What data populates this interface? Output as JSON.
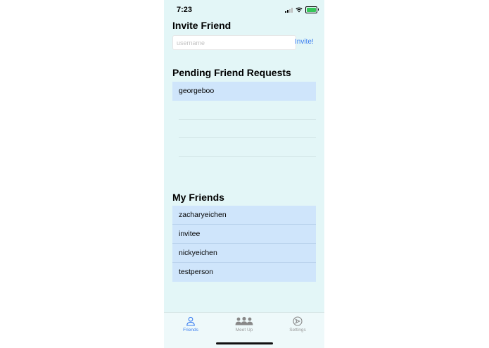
{
  "status": {
    "time": "7:23"
  },
  "invite": {
    "title": "Invite Friend",
    "username_placeholder": "username",
    "username_value": "",
    "invite_label": "Invite!"
  },
  "pending": {
    "title": "Pending Friend Requests",
    "items": [
      {
        "name": "georgeboo"
      }
    ]
  },
  "friends": {
    "title": "My Friends",
    "items": [
      {
        "name": "zacharyeichen"
      },
      {
        "name": "invitee"
      },
      {
        "name": "nickyeichen"
      },
      {
        "name": "testperson"
      }
    ]
  },
  "tabs": [
    {
      "label": "Friends",
      "icon": "person-icon",
      "active": true
    },
    {
      "label": "Meet Up",
      "icon": "group-icon",
      "active": false
    },
    {
      "label": "Settings",
      "icon": "compass-icon",
      "active": false
    }
  ],
  "colors": {
    "accent": "#3b7ef0",
    "background": "#e3f6f7",
    "row": "#cfe5fb",
    "battery": "#34c759"
  }
}
